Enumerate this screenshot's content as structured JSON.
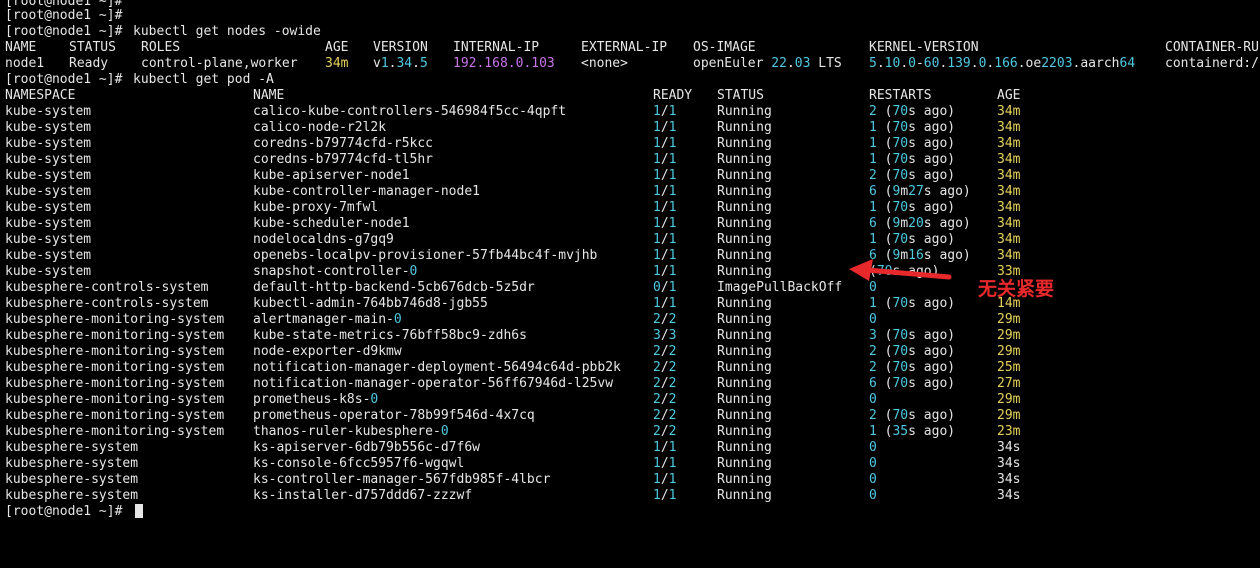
{
  "prompt": "[root@node1 ~]#",
  "commands": {
    "get_nodes": "kubectl get nodes -owide",
    "get_pods": "kubectl get pod -A"
  },
  "nodes_table": {
    "headers": [
      "NAME",
      "STATUS",
      "ROLES",
      "AGE",
      "VERSION",
      "INTERNAL-IP",
      "EXTERNAL-IP",
      "OS-IMAGE",
      "KERNEL-VERSION",
      "CONTAINER-RU"
    ],
    "row": {
      "name": "node1",
      "status": "Ready",
      "roles": "control-plane,worker",
      "age": "34m",
      "version": "v1.34.5",
      "internal_ip": "192.168.0.103",
      "external_ip": "<none>",
      "os_image": "openEuler 22.03 LTS",
      "kernel_version": "5.10.0-60.139.0.166.oe2203.aarch64",
      "container_runtime": "containerd:/"
    }
  },
  "pods_table": {
    "headers": [
      "NAMESPACE",
      "NAME",
      "READY",
      "STATUS",
      "RESTARTS",
      "AGE"
    ],
    "rows": [
      {
        "namespace": "kube-system",
        "name": "calico-kube-controllers-546984f5cc-4qpft",
        "ready": "1/1",
        "status": "Running",
        "restarts": "2 (70s ago)",
        "age": "34m"
      },
      {
        "namespace": "kube-system",
        "name": "calico-node-r2l2k",
        "ready": "1/1",
        "status": "Running",
        "restarts": "1 (70s ago)",
        "age": "34m"
      },
      {
        "namespace": "kube-system",
        "name": "coredns-b79774cfd-r5kcc",
        "ready": "1/1",
        "status": "Running",
        "restarts": "1 (70s ago)",
        "age": "34m"
      },
      {
        "namespace": "kube-system",
        "name": "coredns-b79774cfd-tl5hr",
        "ready": "1/1",
        "status": "Running",
        "restarts": "1 (70s ago)",
        "age": "34m"
      },
      {
        "namespace": "kube-system",
        "name": "kube-apiserver-node1",
        "ready": "1/1",
        "status": "Running",
        "restarts": "2 (70s ago)",
        "age": "34m"
      },
      {
        "namespace": "kube-system",
        "name": "kube-controller-manager-node1",
        "ready": "1/1",
        "status": "Running",
        "restarts": "6 (9m27s ago)",
        "age": "34m"
      },
      {
        "namespace": "kube-system",
        "name": "kube-proxy-7mfwl",
        "ready": "1/1",
        "status": "Running",
        "restarts": "1 (70s ago)",
        "age": "34m"
      },
      {
        "namespace": "kube-system",
        "name": "kube-scheduler-node1",
        "ready": "1/1",
        "status": "Running",
        "restarts": "6 (9m20s ago)",
        "age": "34m"
      },
      {
        "namespace": "kube-system",
        "name": "nodelocaldns-g7gq9",
        "ready": "1/1",
        "status": "Running",
        "restarts": "1 (70s ago)",
        "age": "34m"
      },
      {
        "namespace": "kube-system",
        "name": "openebs-localpv-provisioner-57fb44bc4f-mvjhb",
        "ready": "1/1",
        "status": "Running",
        "restarts": "6 (9m16s ago)",
        "age": "34m"
      },
      {
        "namespace": "kube-system",
        "name": "snapshot-controller-0",
        "ready": "1/1",
        "status": "Running",
        "restarts": "(70s ago)",
        "age": "33m"
      },
      {
        "namespace": "kubesphere-controls-system",
        "name": "default-http-backend-5cb676dcb-5z5dr",
        "ready": "0/1",
        "status": "ImagePullBackOff",
        "restarts": "0",
        "age": ""
      },
      {
        "namespace": "kubesphere-controls-system",
        "name": "kubectl-admin-764bb746d8-jgb55",
        "ready": "1/1",
        "status": "Running",
        "restarts": "1 (70s ago)",
        "age": "14m"
      },
      {
        "namespace": "kubesphere-monitoring-system",
        "name": "alertmanager-main-0",
        "ready": "2/2",
        "status": "Running",
        "restarts": "0",
        "age": "29m"
      },
      {
        "namespace": "kubesphere-monitoring-system",
        "name": "kube-state-metrics-76bff58bc9-zdh6s",
        "ready": "3/3",
        "status": "Running",
        "restarts": "3 (70s ago)",
        "age": "29m"
      },
      {
        "namespace": "kubesphere-monitoring-system",
        "name": "node-exporter-d9kmw",
        "ready": "2/2",
        "status": "Running",
        "restarts": "2 (70s ago)",
        "age": "29m"
      },
      {
        "namespace": "kubesphere-monitoring-system",
        "name": "notification-manager-deployment-56494c64d-pbb2k",
        "ready": "2/2",
        "status": "Running",
        "restarts": "2 (70s ago)",
        "age": "25m"
      },
      {
        "namespace": "kubesphere-monitoring-system",
        "name": "notification-manager-operator-56ff67946d-l25vw",
        "ready": "2/2",
        "status": "Running",
        "restarts": "6 (70s ago)",
        "age": "27m"
      },
      {
        "namespace": "kubesphere-monitoring-system",
        "name": "prometheus-k8s-0",
        "ready": "2/2",
        "status": "Running",
        "restarts": "0",
        "age": "29m"
      },
      {
        "namespace": "kubesphere-monitoring-system",
        "name": "prometheus-operator-78b99f546d-4x7cq",
        "ready": "2/2",
        "status": "Running",
        "restarts": "2 (70s ago)",
        "age": "29m"
      },
      {
        "namespace": "kubesphere-monitoring-system",
        "name": "thanos-ruler-kubesphere-0",
        "ready": "2/2",
        "status": "Running",
        "restarts": "1 (35s ago)",
        "age": "23m"
      },
      {
        "namespace": "kubesphere-system",
        "name": "ks-apiserver-6db79b556c-d7f6w",
        "ready": "1/1",
        "status": "Running",
        "restarts": "0",
        "age": "34s"
      },
      {
        "namespace": "kubesphere-system",
        "name": "ks-console-6fcc5957f6-wgqwl",
        "ready": "1/1",
        "status": "Running",
        "restarts": "0",
        "age": "34s"
      },
      {
        "namespace": "kubesphere-system",
        "name": "ks-controller-manager-567fdb985f-4lbcr",
        "ready": "1/1",
        "status": "Running",
        "restarts": "0",
        "age": "34s"
      },
      {
        "namespace": "kubesphere-system",
        "name": "ks-installer-d757ddd67-zzzwf",
        "ready": "1/1",
        "status": "Running",
        "restarts": "0",
        "age": "34s"
      }
    ]
  },
  "annotation": {
    "text": "无关紧要",
    "color": "#e8292c"
  },
  "colors": {
    "background": "#000000",
    "text": "#e6e6e6",
    "number": "#4ec9e0",
    "age": "#e5d25a",
    "ip": "#c774e8"
  }
}
